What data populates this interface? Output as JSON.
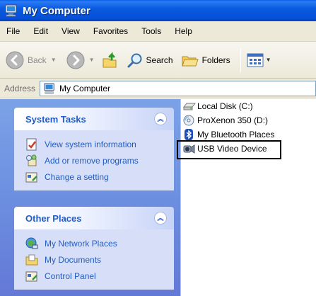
{
  "window": {
    "title": "My Computer"
  },
  "menu": [
    "File",
    "Edit",
    "View",
    "Favorites",
    "Tools",
    "Help"
  ],
  "toolbar": {
    "back": "Back",
    "search": "Search",
    "folders": "Folders"
  },
  "address": {
    "label": "Address",
    "value": "My Computer"
  },
  "system_tasks": {
    "title": "System Tasks",
    "items": [
      "View system information",
      "Add or remove programs",
      "Change a setting"
    ]
  },
  "other_places": {
    "title": "Other Places",
    "items": [
      "My Network Places",
      "My Documents",
      "Control Panel"
    ]
  },
  "drives": [
    "Local Disk (C:)",
    "ProXenon 350 (D:)",
    "My Bluetooth Places",
    "USB Video Device"
  ],
  "colors": {
    "title_bar": "#0a5ae0",
    "task_link": "#215dc6",
    "pane_bg": "#7ba2e7",
    "panel_body": "#d6dff7"
  }
}
